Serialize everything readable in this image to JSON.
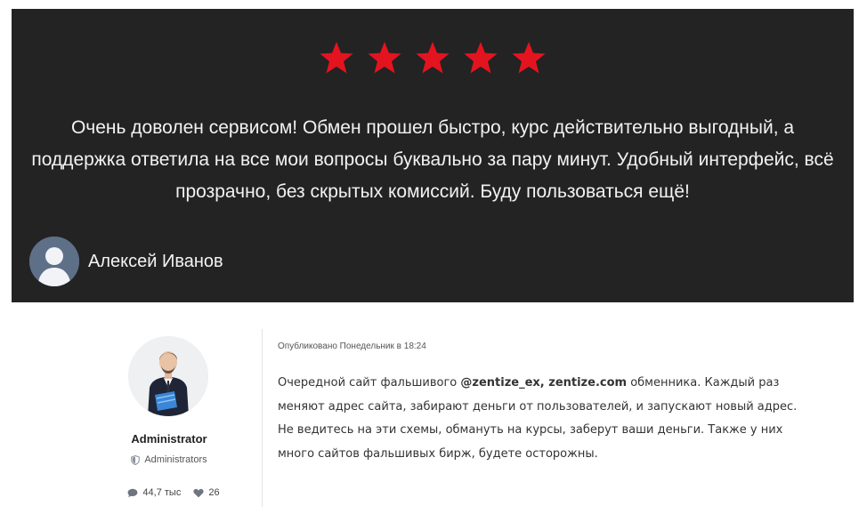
{
  "review": {
    "rating": 5,
    "rating_max": 5,
    "star_color": "#e3141f",
    "text": "Очень доволен сервисом! Обмен прошел быстро, курс действительно выгодный, а поддержка ответила на все мои вопросы буквально за пару минут. Удобный интерфейс, всё прозрачно, без скрытых комиссий. Буду пользоваться ещё!",
    "author_name": "Алексей Иванов",
    "author_avatar_icon": "user-silhouette-icon"
  },
  "post": {
    "author": {
      "name": "Administrator",
      "group": "Administrators",
      "group_icon": "shield-icon",
      "posts_count": "44,7 тыс",
      "posts_icon": "comment-bubble-icon",
      "likes_count": "26",
      "likes_icon": "heart-icon"
    },
    "meta": "Опубликовано Понедельник в 18:24",
    "body": {
      "part1": "Очередной сайт фальшивого ",
      "bold": "@zentize_ex, zentize.com",
      "part2": " обменника. Каждый раз меняют адрес сайта, забирают деньги от пользователей, и запускают новый адрес. Не ведитесь на эти схемы, обмануть на курсы, заберут ваши деньги. Также у них много сайтов фальшивых бирж, будете осторожны."
    }
  }
}
